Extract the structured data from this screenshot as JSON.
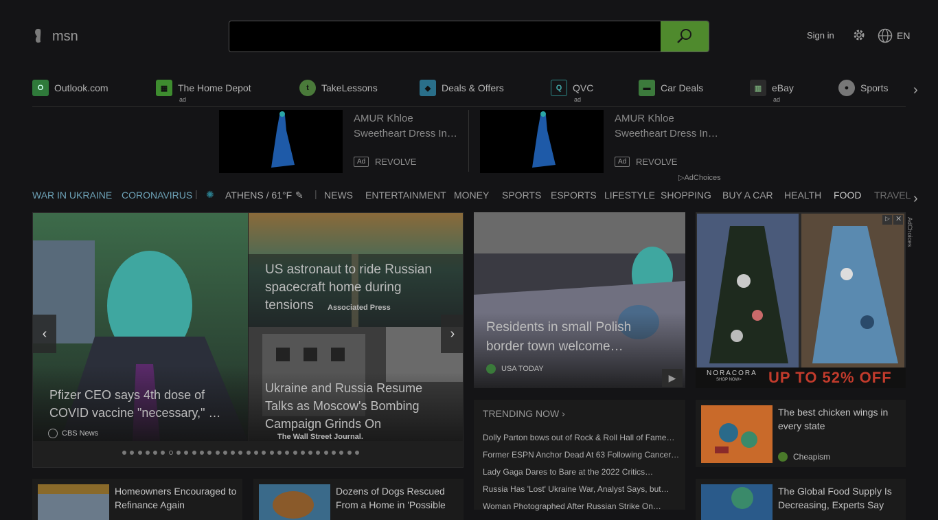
{
  "header": {
    "logo_text": "msn",
    "search": {
      "value": "",
      "placeholder": ""
    },
    "sign_in": "Sign in",
    "language": "EN"
  },
  "quick_links": [
    {
      "label": "Outlook.com",
      "icon": "outlook-icon",
      "ad": ""
    },
    {
      "label": "The Home Depot",
      "icon": "home-depot-icon",
      "ad": "ad"
    },
    {
      "label": "TakeLessons",
      "icon": "takelessons-icon",
      "ad": ""
    },
    {
      "label": "Deals & Offers",
      "icon": "deals-icon",
      "ad": ""
    },
    {
      "label": "QVC",
      "icon": "qvc-icon",
      "ad": "ad"
    },
    {
      "label": "Car Deals",
      "icon": "car-icon",
      "ad": ""
    },
    {
      "label": "eBay",
      "icon": "ebay-icon",
      "ad": "ad"
    },
    {
      "label": "Sports",
      "icon": "sports-icon",
      "ad": ""
    }
  ],
  "ads": [
    {
      "title": "AMUR Khloe Sweetheart Dress In…",
      "badge": "Ad",
      "source": "REVOLVE"
    },
    {
      "title": "AMUR Khloe Sweetheart Dress In…",
      "badge": "Ad",
      "source": "REVOLVE"
    }
  ],
  "ad_choices": "AdChoices",
  "nav": {
    "items": [
      "WAR IN UKRAINE",
      "CORONAVIRUS",
      "ATHENS / 61°F",
      "NEWS",
      "ENTERTAINMENT",
      "MONEY",
      "SPORTS",
      "ESPORTS",
      "LIFESTYLE",
      "SHOPPING",
      "BUY A CAR",
      "HEALTH",
      "FOOD",
      "TRAVEL"
    ]
  },
  "hero": {
    "left": {
      "title": "Pfizer CEO says 4th dose of COVID vaccine \"necessary,\" …",
      "source": "CBS News"
    },
    "top_right": {
      "title": "US astronaut to ride Russian spacecraft home during tensions",
      "source": "Associated Press"
    },
    "bottom_right": {
      "title": "Ukraine and Russia Resume Talks as Moscow's Bombing Campaign Grinds On",
      "source": "The Wall Street Journal."
    },
    "dot_count": 31,
    "active_dot": 6
  },
  "middle_story": {
    "title": "Residents in small Polish border town welcome…",
    "source": "USA TODAY"
  },
  "trending": {
    "heading": "TRENDING NOW ›",
    "items": [
      "Dolly Parton bows out of Rock & Roll Hall of Fame…",
      "Former ESPN Anchor Dead At 63 Following Cancer…",
      "Lady Gaga Dares to Bare at the 2022 Critics…",
      "Russia Has 'Lost' Ukraine War, Analyst Says, but…",
      "Woman Photographed After Russian Strike On…"
    ]
  },
  "right_ad": {
    "brand": "NORACORA",
    "shop": "SHOP NOW>",
    "offer": "UP TO 52% OFF",
    "ad_choices": "AdChoices"
  },
  "cards": [
    {
      "title": "The best chicken wings in every state",
      "source": "Cheapism"
    },
    {
      "title": "Homeowners Encouraged to Refinance Again"
    },
    {
      "title": "Dozens of Dogs Rescued From a Home in 'Possible"
    },
    {
      "title": "The Global Food Supply Is Decreasing, Experts Say"
    }
  ],
  "colors": {
    "accent": "#4f8a2d",
    "background": "#141416"
  }
}
